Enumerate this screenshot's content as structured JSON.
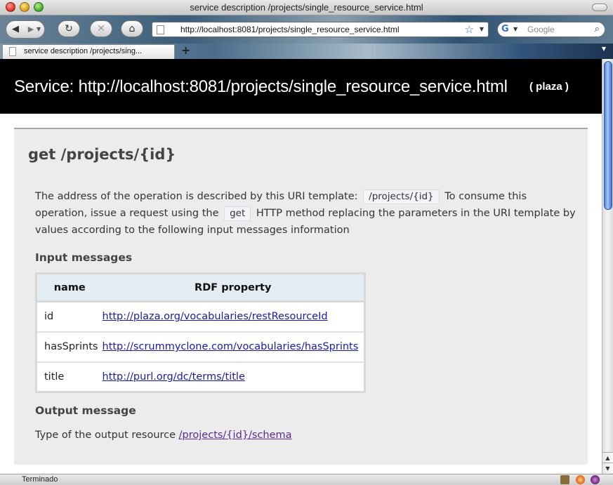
{
  "window": {
    "title": "service description /projects/single_resource_service.html"
  },
  "toolbar": {
    "back_icon": "back-arrow-icon",
    "forward_icon": "forward-arrow-icon",
    "reload_glyph": "↻",
    "stop_glyph": "✕",
    "home_glyph": "⌂",
    "url": "http://localhost:8081/projects/single_resource_service.html",
    "search_placeholder": "Google"
  },
  "tab": {
    "label": "service description /projects/sing..."
  },
  "header": {
    "title": "Service: http://localhost:8081/projects/single_resource_service.html",
    "badge": "( plaza )"
  },
  "operation": {
    "title": "get /projects/{id}",
    "desc_part1": "The address of the operation is described by this URI template:",
    "uri_template": "/projects/{id}",
    "desc_part2": "To consume this operation, issue a request using the",
    "method": "get",
    "desc_part3": "HTTP method replacing the parameters in the URI template by values according to the following input messages information",
    "input_heading": "Input messages",
    "table": {
      "headers": [
        "name",
        "RDF property"
      ],
      "rows": [
        {
          "name": "id",
          "property": "http://plaza.org/vocabularies/restResourceId"
        },
        {
          "name": "hasSprints",
          "property": "http://scrummyclone.com/vocabularies/hasSprints"
        },
        {
          "name": "title",
          "property": "http://purl.org/dc/terms/title"
        }
      ]
    },
    "output_heading": "Output message",
    "output_text": "Type of the output resource",
    "output_link": "/projects/{id}/schema"
  },
  "status": {
    "text": "Terminado"
  },
  "colors": {
    "header_bg": "#000000",
    "link": "#1a1aa8",
    "visited_link": "#5a2b8a",
    "box_bg": "#ececec",
    "table_header_bg": "#e4ecf4"
  }
}
